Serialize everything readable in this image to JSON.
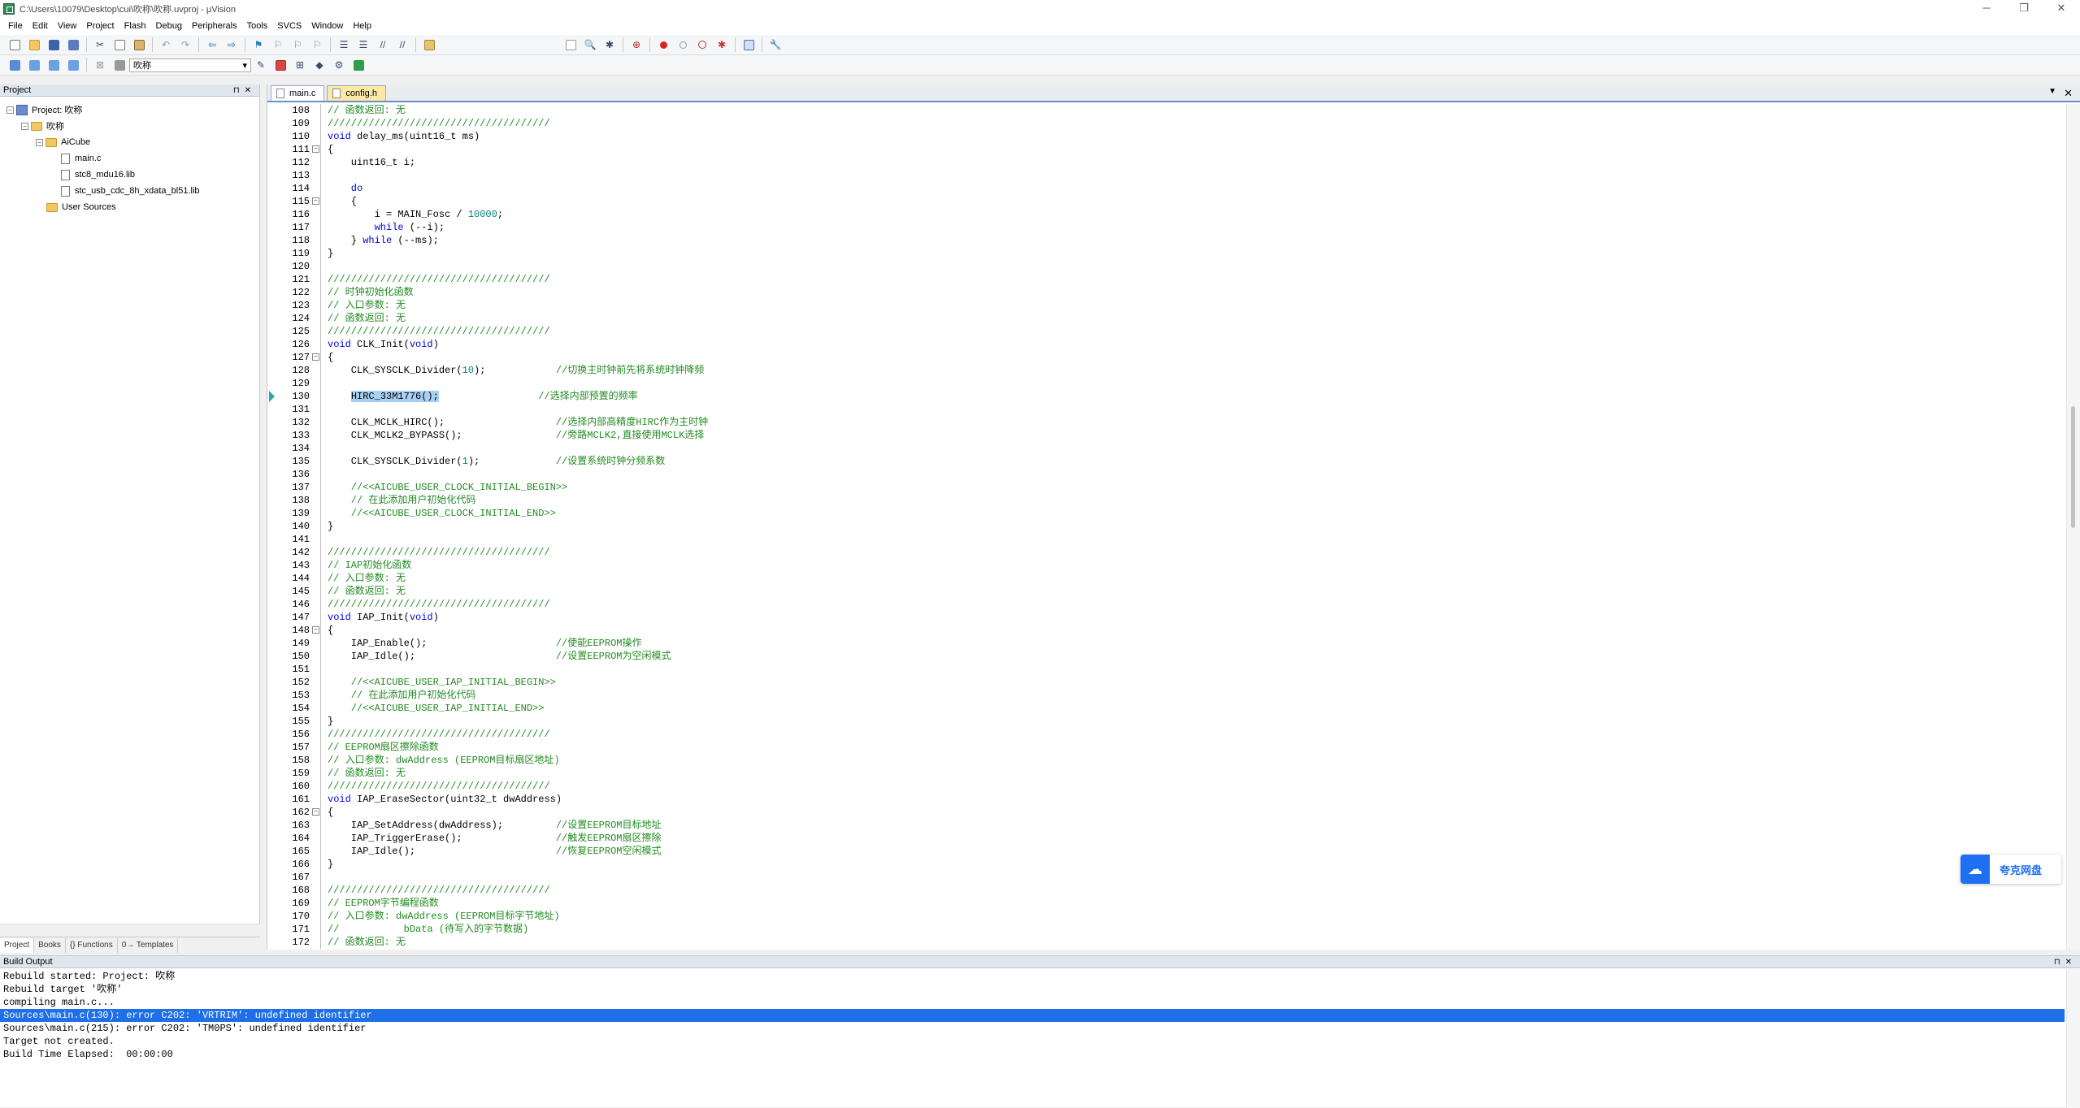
{
  "window": {
    "title": "C:\\Users\\10079\\Desktop\\cui\\吹称\\吹称.uvproj - µVision",
    "controls": [
      "─",
      "❐",
      "✕"
    ]
  },
  "menu": [
    "File",
    "Edit",
    "View",
    "Project",
    "Flash",
    "Debug",
    "Peripherals",
    "Tools",
    "SVCS",
    "Window",
    "Help"
  ],
  "toolbar2": {
    "target_select": "吹称"
  },
  "project_panel": {
    "title": "Project",
    "tree": [
      {
        "level": 0,
        "kind": "project",
        "expand": "⊟",
        "label": "Project: 吹称"
      },
      {
        "level": 1,
        "kind": "folder",
        "expand": "⊟",
        "label": "吹称"
      },
      {
        "level": 2,
        "kind": "folder",
        "expand": "⊟",
        "label": "AiCube"
      },
      {
        "level": 3,
        "kind": "file",
        "expand": "",
        "label": "main.c"
      },
      {
        "level": 3,
        "kind": "file",
        "expand": "",
        "label": "stc8_mdu16.lib"
      },
      {
        "level": 3,
        "kind": "file",
        "expand": "",
        "label": "stc_usb_cdc_8h_xdata_bl51.lib"
      },
      {
        "level": 2,
        "kind": "folder",
        "expand": "",
        "label": "User Sources"
      }
    ],
    "tabs": [
      "Project",
      "Books",
      "{} Functions",
      "0→ Templates"
    ]
  },
  "editor": {
    "tabs": [
      {
        "label": "main.c",
        "active": true
      },
      {
        "label": "config.h",
        "active": false
      }
    ],
    "lines": [
      {
        "n": "108",
        "f": "",
        "t": [
          [
            "c-cm",
            "// 函数返回: 无"
          ]
        ]
      },
      {
        "n": "109",
        "f": "",
        "t": [
          [
            "c-cm",
            "//////////////////////////////////////"
          ]
        ]
      },
      {
        "n": "110",
        "f": "",
        "t": [
          [
            "c-kw",
            "void"
          ],
          [
            "",
            " delay_ms(uint16_t ms)"
          ]
        ]
      },
      {
        "n": "111",
        "f": "⊟",
        "t": [
          [
            "",
            "{"
          ]
        ]
      },
      {
        "n": "112",
        "f": "",
        "t": [
          [
            "",
            "    uint16_t i;"
          ]
        ]
      },
      {
        "n": "113",
        "f": "",
        "t": [
          [
            "",
            ""
          ]
        ]
      },
      {
        "n": "114",
        "f": "",
        "t": [
          [
            "c-kw",
            "    do"
          ]
        ]
      },
      {
        "n": "115",
        "f": "⊟",
        "t": [
          [
            "",
            "    {"
          ]
        ]
      },
      {
        "n": "116",
        "f": "",
        "t": [
          [
            "",
            "        i = MAIN_Fosc / "
          ],
          [
            "c-nm",
            "10000"
          ],
          [
            "",
            ";"
          ]
        ]
      },
      {
        "n": "117",
        "f": "",
        "t": [
          [
            "c-kw",
            "        while"
          ],
          [
            "",
            " (--i);"
          ]
        ]
      },
      {
        "n": "118",
        "f": "",
        "t": [
          [
            "",
            "    } "
          ],
          [
            "c-kw",
            "while"
          ],
          [
            "",
            " (--ms);"
          ]
        ]
      },
      {
        "n": "119",
        "f": "",
        "t": [
          [
            "",
            "}"
          ]
        ]
      },
      {
        "n": "120",
        "f": "",
        "t": [
          [
            "",
            ""
          ]
        ]
      },
      {
        "n": "121",
        "f": "",
        "t": [
          [
            "c-cm",
            "//////////////////////////////////////"
          ]
        ]
      },
      {
        "n": "122",
        "f": "",
        "t": [
          [
            "c-cm",
            "// 时钟初始化函数"
          ]
        ]
      },
      {
        "n": "123",
        "f": "",
        "t": [
          [
            "c-cm",
            "// 入口参数: 无"
          ]
        ]
      },
      {
        "n": "124",
        "f": "",
        "t": [
          [
            "c-cm",
            "// 函数返回: 无"
          ]
        ]
      },
      {
        "n": "125",
        "f": "",
        "t": [
          [
            "c-cm",
            "//////////////////////////////////////"
          ]
        ]
      },
      {
        "n": "126",
        "f": "",
        "t": [
          [
            "c-kw",
            "void"
          ],
          [
            "",
            " CLK_Init("
          ],
          [
            "c-kw",
            "void"
          ],
          [
            "",
            ")"
          ]
        ]
      },
      {
        "n": "127",
        "f": "⊟",
        "t": [
          [
            "",
            "{"
          ]
        ]
      },
      {
        "n": "128",
        "f": "",
        "t": [
          [
            "",
            "    CLK_SYSCLK_Divider("
          ],
          [
            "c-nm",
            "10"
          ],
          [
            "",
            ");            "
          ],
          [
            "c-cm",
            "//切换主时钟前先将系统时钟降频"
          ]
        ]
      },
      {
        "n": "129",
        "f": "",
        "t": [
          [
            "",
            ""
          ]
        ]
      },
      {
        "n": "130",
        "f": "",
        "cur": true,
        "t": [
          [
            "",
            "    "
          ],
          [
            "c-hl",
            "HIRC_33M1776();"
          ],
          [
            "",
            "                 "
          ],
          [
            "c-cm",
            "//选择内部预置的频率"
          ]
        ]
      },
      {
        "n": "131",
        "f": "",
        "t": [
          [
            "",
            ""
          ]
        ]
      },
      {
        "n": "132",
        "f": "",
        "t": [
          [
            "",
            "    CLK_MCLK_HIRC();                   "
          ],
          [
            "c-cm",
            "//选择内部高精度HIRC作为主时钟"
          ]
        ]
      },
      {
        "n": "133",
        "f": "",
        "t": [
          [
            "",
            "    CLK_MCLK2_BYPASS();                "
          ],
          [
            "c-cm",
            "//旁路MCLK2,直接使用MCLK选择"
          ]
        ]
      },
      {
        "n": "134",
        "f": "",
        "t": [
          [
            "",
            ""
          ]
        ]
      },
      {
        "n": "135",
        "f": "",
        "t": [
          [
            "",
            "    CLK_SYSCLK_Divider("
          ],
          [
            "c-nm",
            "1"
          ],
          [
            "",
            ");             "
          ],
          [
            "c-cm",
            "//设置系统时钟分频系数"
          ]
        ]
      },
      {
        "n": "136",
        "f": "",
        "t": [
          [
            "",
            ""
          ]
        ]
      },
      {
        "n": "137",
        "f": "",
        "t": [
          [
            "c-cm",
            "    //<<AICUBE_USER_CLOCK_INITIAL_BEGIN>>"
          ]
        ]
      },
      {
        "n": "138",
        "f": "",
        "t": [
          [
            "c-cm",
            "    // 在此添加用户初始化代码"
          ]
        ]
      },
      {
        "n": "139",
        "f": "",
        "t": [
          [
            "c-cm",
            "    //<<AICUBE_USER_CLOCK_INITIAL_END>>"
          ]
        ]
      },
      {
        "n": "140",
        "f": "",
        "t": [
          [
            "",
            "}"
          ]
        ]
      },
      {
        "n": "141",
        "f": "",
        "t": [
          [
            "",
            ""
          ]
        ]
      },
      {
        "n": "142",
        "f": "",
        "t": [
          [
            "c-cm",
            "//////////////////////////////////////"
          ]
        ]
      },
      {
        "n": "143",
        "f": "",
        "t": [
          [
            "c-cm",
            "// IAP初始化函数"
          ]
        ]
      },
      {
        "n": "144",
        "f": "",
        "t": [
          [
            "c-cm",
            "// 入口参数: 无"
          ]
        ]
      },
      {
        "n": "145",
        "f": "",
        "t": [
          [
            "c-cm",
            "// 函数返回: 无"
          ]
        ]
      },
      {
        "n": "146",
        "f": "",
        "t": [
          [
            "c-cm",
            "//////////////////////////////////////"
          ]
        ]
      },
      {
        "n": "147",
        "f": "",
        "t": [
          [
            "c-kw",
            "void"
          ],
          [
            "",
            " IAP_Init("
          ],
          [
            "c-kw",
            "void"
          ],
          [
            "",
            ")"
          ]
        ]
      },
      {
        "n": "148",
        "f": "⊟",
        "t": [
          [
            "",
            "{"
          ]
        ]
      },
      {
        "n": "149",
        "f": "",
        "t": [
          [
            "",
            "    IAP_Enable();                      "
          ],
          [
            "c-cm",
            "//使能EEPROM操作"
          ]
        ]
      },
      {
        "n": "150",
        "f": "",
        "t": [
          [
            "",
            "    IAP_Idle();                        "
          ],
          [
            "c-cm",
            "//设置EEPROM为空闲模式"
          ]
        ]
      },
      {
        "n": "151",
        "f": "",
        "t": [
          [
            "",
            ""
          ]
        ]
      },
      {
        "n": "152",
        "f": "",
        "t": [
          [
            "c-cm",
            "    //<<AICUBE_USER_IAP_INITIAL_BEGIN>>"
          ]
        ]
      },
      {
        "n": "153",
        "f": "",
        "t": [
          [
            "c-cm",
            "    // 在此添加用户初始化代码"
          ]
        ]
      },
      {
        "n": "154",
        "f": "",
        "t": [
          [
            "c-cm",
            "    //<<AICUBE_USER_IAP_INITIAL_END>>"
          ]
        ]
      },
      {
        "n": "155",
        "f": "",
        "t": [
          [
            "",
            "}"
          ]
        ]
      },
      {
        "n": "156",
        "f": "",
        "t": [
          [
            "c-cm",
            "//////////////////////////////////////"
          ]
        ]
      },
      {
        "n": "157",
        "f": "",
        "t": [
          [
            "c-cm",
            "// EEPROM扇区擦除函数"
          ]
        ]
      },
      {
        "n": "158",
        "f": "",
        "t": [
          [
            "c-cm",
            "// 入口参数: dwAddress (EEPROM目标扇区地址)"
          ]
        ]
      },
      {
        "n": "159",
        "f": "",
        "t": [
          [
            "c-cm",
            "// 函数返回: 无"
          ]
        ]
      },
      {
        "n": "160",
        "f": "",
        "t": [
          [
            "c-cm",
            "//////////////////////////////////////"
          ]
        ]
      },
      {
        "n": "161",
        "f": "",
        "t": [
          [
            "c-kw",
            "void"
          ],
          [
            "",
            " IAP_EraseSector(uint32_t dwAddress)"
          ]
        ]
      },
      {
        "n": "162",
        "f": "⊟",
        "t": [
          [
            "",
            "{"
          ]
        ]
      },
      {
        "n": "163",
        "f": "",
        "t": [
          [
            "",
            "    IAP_SetAddress(dwAddress);         "
          ],
          [
            "c-cm",
            "//设置EEPROM目标地址"
          ]
        ]
      },
      {
        "n": "164",
        "f": "",
        "t": [
          [
            "",
            "    IAP_TriggerErase();                "
          ],
          [
            "c-cm",
            "//触发EEPROM扇区擦除"
          ]
        ]
      },
      {
        "n": "165",
        "f": "",
        "t": [
          [
            "",
            "    IAP_Idle();                        "
          ],
          [
            "c-cm",
            "//恢复EEPROM空闲模式"
          ]
        ]
      },
      {
        "n": "166",
        "f": "",
        "t": [
          [
            "",
            "}"
          ]
        ]
      },
      {
        "n": "167",
        "f": "",
        "t": [
          [
            "",
            ""
          ]
        ]
      },
      {
        "n": "168",
        "f": "",
        "t": [
          [
            "c-cm",
            "//////////////////////////////////////"
          ]
        ]
      },
      {
        "n": "169",
        "f": "",
        "t": [
          [
            "c-cm",
            "// EEPROM字节编程函数"
          ]
        ]
      },
      {
        "n": "170",
        "f": "",
        "t": [
          [
            "c-cm",
            "// 入口参数: dwAddress (EEPROM目标字节地址)"
          ]
        ]
      },
      {
        "n": "171",
        "f": "",
        "t": [
          [
            "c-cm",
            "//           bData (待写入的字节数据)"
          ]
        ]
      },
      {
        "n": "172",
        "f": "",
        "t": [
          [
            "c-cm",
            "// 函数返回: 无"
          ]
        ]
      }
    ]
  },
  "overlay": {
    "cloud_label": "夸克网盘"
  },
  "build_output": {
    "title": "Build Output",
    "lines": [
      {
        "text": "Rebuild started: Project: 吹称",
        "selected": false
      },
      {
        "text": "Rebuild target '吹称'",
        "selected": false
      },
      {
        "text": "compiling main.c...",
        "selected": false
      },
      {
        "text": "Sources\\main.c(130): error C202: 'VRTRIM': undefined identifier",
        "selected": true
      },
      {
        "text": "Sources\\main.c(215): error C202: 'TM0PS': undefined identifier",
        "selected": false
      },
      {
        "text": "Target not created.",
        "selected": false
      },
      {
        "text": "Build Time Elapsed:  00:00:00",
        "selected": false
      }
    ]
  }
}
